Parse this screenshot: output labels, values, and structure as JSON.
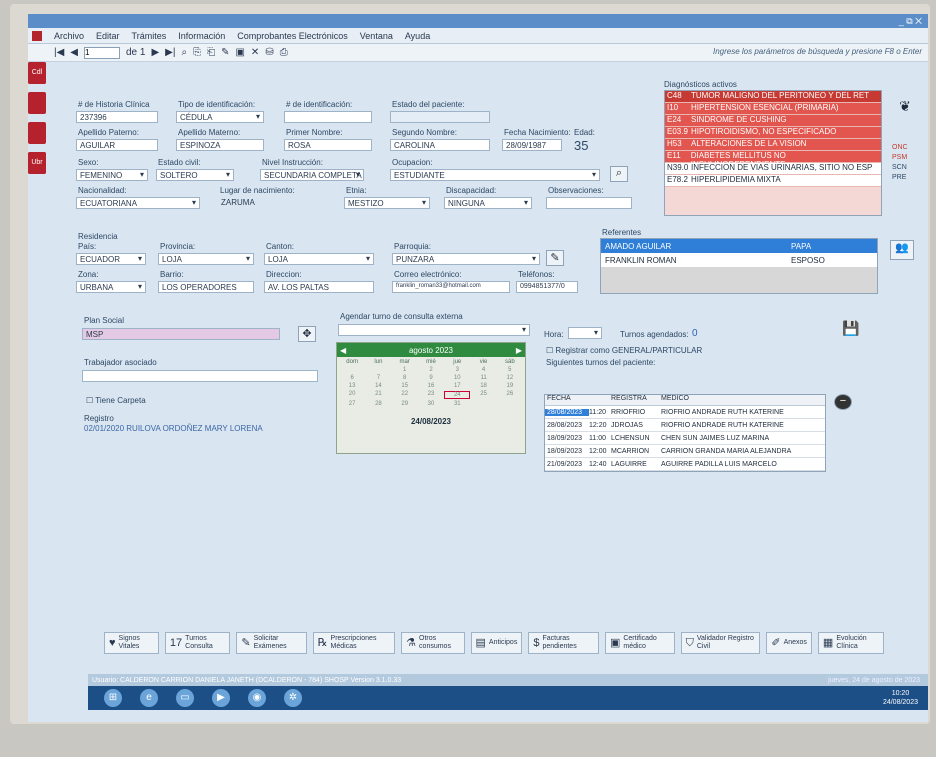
{
  "menu": {
    "items": [
      "Archivo",
      "Editar",
      "Trámites",
      "Información",
      "Comprobantes Electrónicos",
      "Ventana",
      "Ayuda"
    ],
    "window_ctrls": "_ ⧉ ✕"
  },
  "toolbar": {
    "record": "1",
    "of": "de 1",
    "hint": "Ingrese los parámetros de búsqueda y presione F8 o Enter"
  },
  "side_tabs": [
    "Cdl",
    "",
    "",
    "Ubr"
  ],
  "patient": {
    "labels": {
      "hc": "# de Historia Clínica",
      "tipo": "Tipo de identificación:",
      "num": "# de identificación:",
      "estado": "Estado del paciente:",
      "ap_pat": "Apellido Paterno:",
      "ap_mat": "Apellido Materno:",
      "nombre1": "Primer Nombre:",
      "nombre2": "Segundo Nombre:",
      "fnac": "Fecha Nacimiento:",
      "edad": "Edad:",
      "sexo": "Sexo:",
      "civil": "Estado civil:",
      "instr": "Nivel Instrucción:",
      "ocup": "Ocupacion:",
      "nac": "Nacionalidad:",
      "lugar": "Lugar de nacimiento:",
      "etnia": "Etnia:",
      "disc": "Discapacidad:",
      "obs": "Observaciones:"
    },
    "hc": "237396",
    "tipo": "CÉDULA",
    "ap_pat": "AGUILAR",
    "ap_mat": "ESPINOZA",
    "nombre1": "ROSA",
    "nombre2": "CAROLINA",
    "fnac": "28/09/1987",
    "edad": "35",
    "sexo": "FEMENINO",
    "civil": "SOLTERO",
    "instr": "SECUNDARIA COMPLETA",
    "ocup": "ESTUDIANTE",
    "nac": "ECUATORIANA",
    "lugar": "ZARUMA",
    "etnia": "MESTIZO",
    "disc": "NINGUNA"
  },
  "diagnosticos": {
    "title": "Diagnósticos activos",
    "rows": [
      {
        "code": "C48",
        "desc": "TUMOR MALIGNO DEL PERITONEO Y DEL RET",
        "style": "hl"
      },
      {
        "code": "I10",
        "desc": "HIPERTENSION ESENCIAL (PRIMARIA)",
        "style": "red"
      },
      {
        "code": "E24",
        "desc": "SINDROME DE CUSHING",
        "style": "red"
      },
      {
        "code": "E03.9",
        "desc": "HIPOTIROIDISMO, NO ESPECIFICADO",
        "style": "red"
      },
      {
        "code": "H53",
        "desc": "ALTERACIONES DE LA VISION",
        "style": "red"
      },
      {
        "code": "E11",
        "desc": "DIABETES MELLITUS NO INSULINODEPENDIENTE",
        "style": "red"
      },
      {
        "code": "N39.0",
        "desc": "INFECCION DE VIAS URINARIAS, SITIO NO ESP",
        "style": "white"
      },
      {
        "code": "E78.2",
        "desc": "HIPERLIPIDEMIA MIXTA",
        "style": "white"
      }
    ]
  },
  "right_labels": [
    "ONC",
    "PSM",
    "SCN",
    "PRE"
  ],
  "residencia": {
    "title": "Residencia",
    "labels": {
      "pais": "País:",
      "prov": "Provincia:",
      "canton": "Canton:",
      "parroquia": "Parroquia:",
      "zona": "Zona:",
      "barrio": "Barrio:",
      "dir": "Direccion:",
      "correo": "Correo electrónico:",
      "tel": "Teléfonos:"
    },
    "pais": "ECUADOR",
    "prov": "LOJA",
    "canton": "LOJA",
    "parroquia": "PUNZARA",
    "zona": "URBANA",
    "barrio": "LOS OPERADORES",
    "dir": "AV. LOS PALTAS",
    "correo": "franklin_roman33@hotmail.com",
    "tel": "0994851377/0"
  },
  "referentes": {
    "title": "Referentes",
    "rows": [
      {
        "name": "AMADO AGUILAR",
        "rel": "PAPA"
      },
      {
        "name": "FRANKLIN ROMAN",
        "rel": "ESPOSO"
      }
    ]
  },
  "plan": {
    "title": "Plan Social",
    "value": "MSP",
    "trab": "Trabajador asociado",
    "carpeta": "Tiene Carpeta",
    "registro": "Registro",
    "reg_text": "02/01/2020    RUILOVA ORDOÑEZ MARY LORENA"
  },
  "agenda": {
    "title": "Agendar turno de consulta externa",
    "month": "agosto 2023",
    "days": [
      "dom",
      "lun",
      "mar",
      "mié",
      "jue",
      "vie",
      "sáb"
    ],
    "today": "24/08/2023",
    "dates": [
      "",
      "",
      "1",
      "2",
      "3",
      "4",
      "5",
      "6",
      "7",
      "8",
      "9",
      "10",
      "11",
      "12",
      "13",
      "14",
      "15",
      "16",
      "17",
      "18",
      "19",
      "20",
      "21",
      "22",
      "23",
      "24",
      "25",
      "26",
      "27",
      "28",
      "29",
      "30",
      "31",
      "",
      ""
    ]
  },
  "turnos": {
    "hora": "Hora:",
    "agendados": "Turnos agendados:",
    "count": "0",
    "general": "Registrar como GENERAL/PARTICULAR",
    "sig": "Siguientes turnos del paciente:",
    "headers": [
      "FECHA",
      "",
      "REGISTRA",
      "MEDICO"
    ],
    "rows": [
      {
        "fecha": "28/08/2023",
        "hora": "11:20",
        "reg": "RRIOFRIO",
        "med": "RIOFRIO ANDRADE RUTH KATERINE"
      },
      {
        "fecha": "28/08/2023",
        "hora": "12:20",
        "reg": "JDROJAS",
        "med": "RIOFRIO ANDRADE RUTH KATERINE"
      },
      {
        "fecha": "18/09/2023",
        "hora": "11:00",
        "reg": "LCHENSUN",
        "med": "CHEN SUN JAIMES LUZ MARINA"
      },
      {
        "fecha": "18/09/2023",
        "hora": "12:00",
        "reg": "MCARRION",
        "med": "CARRION GRANDA MARIA ALEJANDRA"
      },
      {
        "fecha": "21/09/2023",
        "hora": "12:40",
        "reg": "LAGUIRRE",
        "med": "AGUIRRE PADILLA LUIS MARCELO"
      }
    ]
  },
  "bottom_buttons": [
    {
      "icon": "signos-icon",
      "glyph": "♥",
      "label": "Signos Vitales"
    },
    {
      "icon": "turnos-icon",
      "glyph": "17",
      "label": "Turnos Consulta"
    },
    {
      "icon": "examenes-icon",
      "glyph": "✎",
      "label": "Solicitar Exámenes"
    },
    {
      "icon": "prescripcion-icon",
      "glyph": "℞",
      "label": "Prescripciones Médicas"
    },
    {
      "icon": "consumos-icon",
      "glyph": "⚗",
      "label": "Otros consumos"
    },
    {
      "icon": "anticipos-icon",
      "glyph": "▤",
      "label": "Anticipos"
    },
    {
      "icon": "facturas-icon",
      "glyph": "$",
      "label": "Facturas pendientes"
    },
    {
      "icon": "certificado-icon",
      "glyph": "▣",
      "label": "Certificado médico"
    },
    {
      "icon": "validador-icon",
      "glyph": "⛉",
      "label": "Validador Registro Civil"
    },
    {
      "icon": "anexos-icon",
      "glyph": "✐",
      "label": "Anexos"
    },
    {
      "icon": "evolucion-icon",
      "glyph": "▦",
      "label": "Evolución Clínica"
    }
  ],
  "status": {
    "user": "Usuario: CALDERON CARRION DANIELA JANETH (DCALDERON - 784)   SHOSP Version 3.1.0.33",
    "date": "jueves, 24 de agosto de 2023"
  },
  "clock": {
    "time": "10:20",
    "date": "24/08/2023"
  }
}
